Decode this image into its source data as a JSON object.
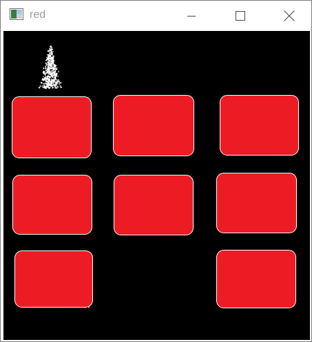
{
  "window": {
    "title": "red",
    "controls": [
      "minimize",
      "maximize",
      "close"
    ]
  },
  "canvas": {
    "background": "#000000",
    "box_color": "#ed1c24",
    "box_outline": "#ffffff",
    "box_count": 8,
    "noise_color": "#ffffff"
  },
  "icons": {
    "app": "image-app-icon",
    "minimize": "minimize-icon",
    "maximize": "maximize-icon",
    "close": "close-icon"
  }
}
